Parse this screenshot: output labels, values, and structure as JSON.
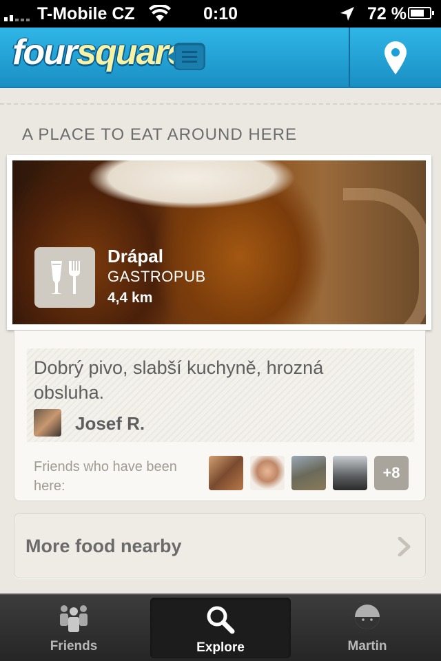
{
  "status_bar": {
    "carrier": "T-Mobile CZ",
    "time": "0:10",
    "battery_percent": "72 %",
    "battery_level": 0.72
  },
  "navbar": {
    "logo_part1": "four",
    "logo_part2": "square",
    "menu_icon": "menu-icon",
    "location_icon": "location-pin-icon"
  },
  "section": {
    "title": "A PLACE TO EAT AROUND HERE"
  },
  "venue": {
    "name": "Drápal",
    "category": "GASTROPUB",
    "distance": "4,4 km",
    "category_icon": "food-drink-icon"
  },
  "tip": {
    "text": "Dobrý pivo, slabší kuchyně, hrozná obsluha.",
    "author": "Josef R."
  },
  "friends": {
    "label": "Friends who have been here:",
    "more_count": "+8"
  },
  "more_row": {
    "label": "More food nearby"
  },
  "tabs": [
    {
      "label": "Friends",
      "icon": "friends-icon"
    },
    {
      "label": "Explore",
      "icon": "search-icon",
      "selected": true
    },
    {
      "label": "Martin",
      "icon": "profile-icon"
    }
  ],
  "colors": {
    "brand_blue": "#1a9fd8",
    "logo_yellow": "#f6f2a6",
    "background": "#ebe8e2",
    "tabbar": "#2b2b2b"
  }
}
